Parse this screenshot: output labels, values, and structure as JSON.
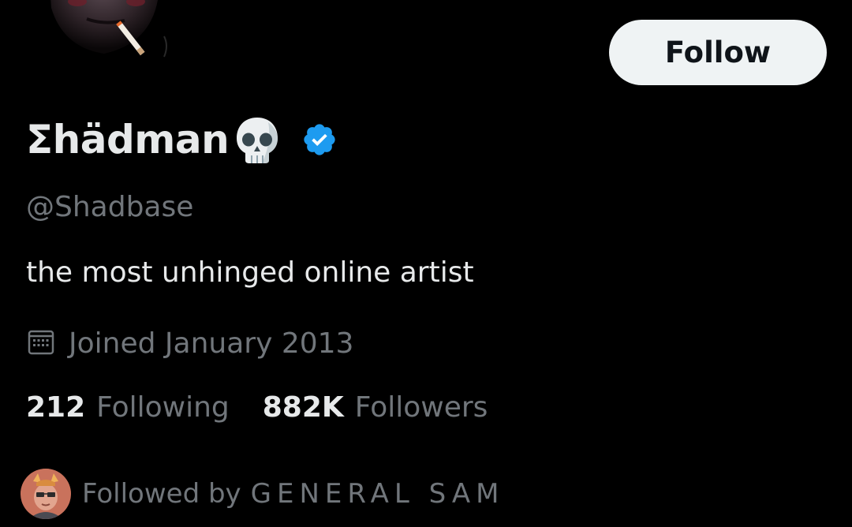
{
  "profile": {
    "display_name": "Σhädman",
    "name_emoji": "skull-emoji",
    "verified_icon": "verified-badge-icon",
    "handle": "@Shadbase",
    "bio": "the most unhinged online artist",
    "joined": "Joined January 2013"
  },
  "actions": {
    "follow_label": "Follow"
  },
  "stats": {
    "following_count": "212",
    "following_label": "Following",
    "followers_count": "882K",
    "followers_label": "Followers"
  },
  "followed_by": {
    "prefix": "Followed by",
    "name": "GENERAL SAM"
  },
  "colors": {
    "background": "#000000",
    "primary_text": "#e7e9ea",
    "secondary_text": "#71767b",
    "verified_blue": "#1d9bf0",
    "button_bg": "#eff3f4"
  }
}
